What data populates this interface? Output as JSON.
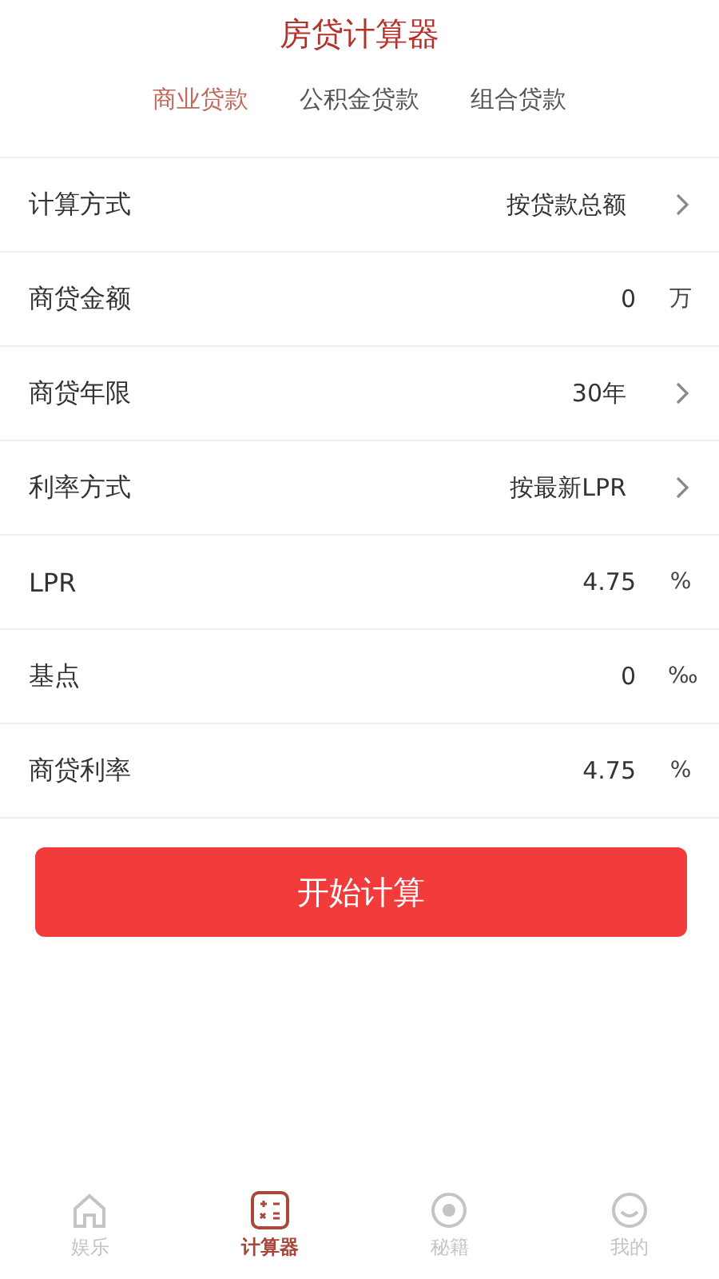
{
  "header": {
    "title": "房贷计算器"
  },
  "tabs": [
    {
      "label": "商业贷款",
      "selected": true
    },
    {
      "label": "公积金贷款",
      "selected": false
    },
    {
      "label": "组合贷款",
      "selected": false
    }
  ],
  "rows": [
    {
      "kind": "select",
      "label": "计算方式",
      "value": "按贷款总额"
    },
    {
      "kind": "input",
      "label": "商贷金额",
      "value": "0",
      "unit": "万"
    },
    {
      "kind": "select",
      "label": "商贷年限",
      "value": "30年"
    },
    {
      "kind": "select",
      "label": "利率方式",
      "value": "按最新LPR"
    },
    {
      "kind": "input",
      "label": "LPR",
      "value": "4.75",
      "unit": "%"
    },
    {
      "kind": "input",
      "label": "基点",
      "value": "0",
      "unit": "‰"
    },
    {
      "kind": "input",
      "label": "商贷利率",
      "value": "4.75",
      "unit": "%"
    }
  ],
  "button": {
    "label": "开始计算"
  },
  "nav": [
    {
      "kind": "home",
      "label": "娱乐",
      "selected": false
    },
    {
      "kind": "calculator",
      "label": "计算器",
      "selected": true
    },
    {
      "kind": "record",
      "label": "秘籍",
      "selected": false
    },
    {
      "kind": "smile",
      "label": "我的",
      "selected": false
    }
  ]
}
